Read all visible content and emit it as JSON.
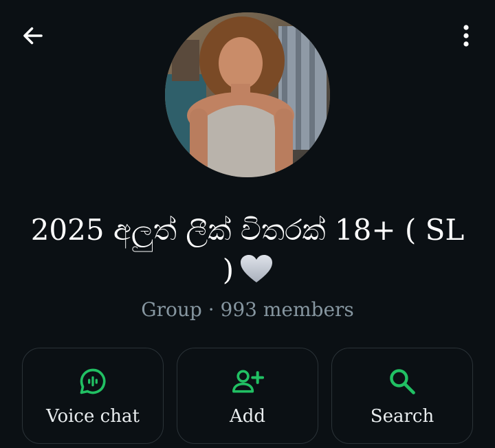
{
  "header": {
    "back_icon": "arrow-left-icon",
    "menu_icon": "more-vertical-icon"
  },
  "profile": {
    "avatar": "group-photo",
    "name": "2025 අලුත් ලීක් විතරක් 18+ ( SL )",
    "name_emoji": "grey-heart-icon",
    "subtitle": "Group · 993 members"
  },
  "actions": [
    {
      "label": "Voice chat",
      "icon": "voice-chat-icon"
    },
    {
      "label": "Add",
      "icon": "add-person-icon"
    },
    {
      "label": "Search",
      "icon": "search-icon"
    }
  ],
  "colors": {
    "background": "#0b1014",
    "accent": "#21c063",
    "text": "#e9edef",
    "muted": "#8696a0",
    "button_border": "#2b3338"
  }
}
